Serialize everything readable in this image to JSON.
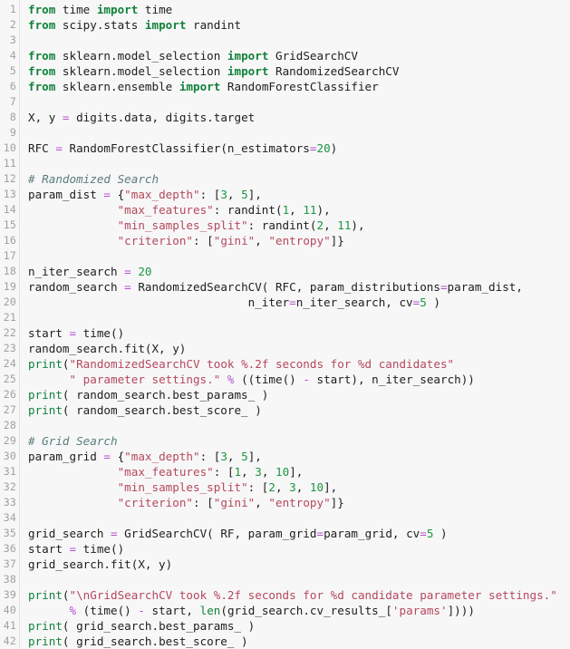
{
  "editor": {
    "name": "python-code-editor",
    "background_color": "#f7f7f7",
    "gutter_color": "#a0a0a0",
    "line_count": 42,
    "colors": {
      "keyword": "#11823b",
      "builtin": "#11823b",
      "string": "#b5485d",
      "number": "#1a9641",
      "operator": "#b452cd",
      "comment": "#5a7d7d",
      "plain": "#202020"
    },
    "line_numbers": [
      1,
      2,
      3,
      4,
      5,
      6,
      7,
      8,
      9,
      10,
      11,
      12,
      13,
      14,
      15,
      16,
      17,
      18,
      19,
      20,
      21,
      22,
      23,
      24,
      25,
      26,
      27,
      28,
      29,
      30,
      31,
      32,
      33,
      34,
      35,
      36,
      37,
      38,
      39,
      40,
      41,
      42
    ],
    "lines": [
      [
        {
          "t": "from ",
          "c": "kw"
        },
        {
          "t": "time ",
          "c": "pl"
        },
        {
          "t": "import",
          "c": "kw"
        },
        {
          "t": " time",
          "c": "pl"
        }
      ],
      [
        {
          "t": "from ",
          "c": "kw"
        },
        {
          "t": "scipy.stats ",
          "c": "pl"
        },
        {
          "t": "import",
          "c": "kw"
        },
        {
          "t": " randint",
          "c": "pl"
        }
      ],
      [],
      [
        {
          "t": "from ",
          "c": "kw"
        },
        {
          "t": "sklearn.model_selection ",
          "c": "pl"
        },
        {
          "t": "import",
          "c": "kw"
        },
        {
          "t": " GridSearchCV",
          "c": "pl"
        }
      ],
      [
        {
          "t": "from ",
          "c": "kw"
        },
        {
          "t": "sklearn.model_selection ",
          "c": "pl"
        },
        {
          "t": "import",
          "c": "kw"
        },
        {
          "t": " RandomizedSearchCV",
          "c": "pl"
        }
      ],
      [
        {
          "t": "from ",
          "c": "kw"
        },
        {
          "t": "sklearn.ensemble ",
          "c": "pl"
        },
        {
          "t": "import",
          "c": "kw"
        },
        {
          "t": " RandomForestClassifier",
          "c": "pl"
        }
      ],
      [],
      [
        {
          "t": "X, y ",
          "c": "pl"
        },
        {
          "t": "=",
          "c": "op"
        },
        {
          "t": " digits.data, digits.target",
          "c": "pl"
        }
      ],
      [],
      [
        {
          "t": "RFC ",
          "c": "pl"
        },
        {
          "t": "=",
          "c": "op"
        },
        {
          "t": " RandomForestClassifier(n_estimators",
          "c": "pl"
        },
        {
          "t": "=",
          "c": "op"
        },
        {
          "t": "20",
          "c": "num"
        },
        {
          "t": ")",
          "c": "pl"
        }
      ],
      [],
      [
        {
          "t": "# Randomized Search",
          "c": "cm"
        }
      ],
      [
        {
          "t": "param_dist ",
          "c": "pl"
        },
        {
          "t": "=",
          "c": "op"
        },
        {
          "t": " {",
          "c": "pl"
        },
        {
          "t": "\"max_depth\"",
          "c": "str"
        },
        {
          "t": ": [",
          "c": "pl"
        },
        {
          "t": "3",
          "c": "num"
        },
        {
          "t": ", ",
          "c": "pl"
        },
        {
          "t": "5",
          "c": "num"
        },
        {
          "t": "],",
          "c": "pl"
        }
      ],
      [
        {
          "t": "             ",
          "c": "pl"
        },
        {
          "t": "\"max_features\"",
          "c": "str"
        },
        {
          "t": ": randint(",
          "c": "pl"
        },
        {
          "t": "1",
          "c": "num"
        },
        {
          "t": ", ",
          "c": "pl"
        },
        {
          "t": "11",
          "c": "num"
        },
        {
          "t": "),",
          "c": "pl"
        }
      ],
      [
        {
          "t": "             ",
          "c": "pl"
        },
        {
          "t": "\"min_samples_split\"",
          "c": "str"
        },
        {
          "t": ": randint(",
          "c": "pl"
        },
        {
          "t": "2",
          "c": "num"
        },
        {
          "t": ", ",
          "c": "pl"
        },
        {
          "t": "11",
          "c": "num"
        },
        {
          "t": "),",
          "c": "pl"
        }
      ],
      [
        {
          "t": "             ",
          "c": "pl"
        },
        {
          "t": "\"criterion\"",
          "c": "str"
        },
        {
          "t": ": [",
          "c": "pl"
        },
        {
          "t": "\"gini\"",
          "c": "str"
        },
        {
          "t": ", ",
          "c": "pl"
        },
        {
          "t": "\"entropy\"",
          "c": "str"
        },
        {
          "t": "]}",
          "c": "pl"
        }
      ],
      [],
      [
        {
          "t": "n_iter_search ",
          "c": "pl"
        },
        {
          "t": "=",
          "c": "op"
        },
        {
          "t": " ",
          "c": "pl"
        },
        {
          "t": "20",
          "c": "num"
        }
      ],
      [
        {
          "t": "random_search ",
          "c": "pl"
        },
        {
          "t": "=",
          "c": "op"
        },
        {
          "t": " RandomizedSearchCV( RFC, param_distributions",
          "c": "pl"
        },
        {
          "t": "=",
          "c": "op"
        },
        {
          "t": "param_dist,",
          "c": "pl"
        }
      ],
      [
        {
          "t": "                                n_iter",
          "c": "pl"
        },
        {
          "t": "=",
          "c": "op"
        },
        {
          "t": "n_iter_search, cv",
          "c": "pl"
        },
        {
          "t": "=",
          "c": "op"
        },
        {
          "t": "5",
          "c": "num"
        },
        {
          "t": " )",
          "c": "pl"
        }
      ],
      [],
      [
        {
          "t": "start ",
          "c": "pl"
        },
        {
          "t": "=",
          "c": "op"
        },
        {
          "t": " time()",
          "c": "pl"
        }
      ],
      [
        {
          "t": "random_search.fit(X, y)",
          "c": "pl"
        }
      ],
      [
        {
          "t": "print",
          "c": "bi"
        },
        {
          "t": "(",
          "c": "pl"
        },
        {
          "t": "\"RandomizedSearchCV took %.2f seconds for %d candidates\"",
          "c": "str"
        }
      ],
      [
        {
          "t": "      ",
          "c": "pl"
        },
        {
          "t": "\" parameter settings.\"",
          "c": "str"
        },
        {
          "t": " ",
          "c": "pl"
        },
        {
          "t": "%",
          "c": "op"
        },
        {
          "t": " ((time() ",
          "c": "pl"
        },
        {
          "t": "-",
          "c": "op"
        },
        {
          "t": " start), n_iter_search))",
          "c": "pl"
        }
      ],
      [
        {
          "t": "print",
          "c": "bi"
        },
        {
          "t": "( random_search.best_params_ )",
          "c": "pl"
        }
      ],
      [
        {
          "t": "print",
          "c": "bi"
        },
        {
          "t": "( random_search.best_score_ )",
          "c": "pl"
        }
      ],
      [],
      [
        {
          "t": "# Grid Search",
          "c": "cm"
        }
      ],
      [
        {
          "t": "param_grid ",
          "c": "pl"
        },
        {
          "t": "=",
          "c": "op"
        },
        {
          "t": " {",
          "c": "pl"
        },
        {
          "t": "\"max_depth\"",
          "c": "str"
        },
        {
          "t": ": [",
          "c": "pl"
        },
        {
          "t": "3",
          "c": "num"
        },
        {
          "t": ", ",
          "c": "pl"
        },
        {
          "t": "5",
          "c": "num"
        },
        {
          "t": "],",
          "c": "pl"
        }
      ],
      [
        {
          "t": "             ",
          "c": "pl"
        },
        {
          "t": "\"max_features\"",
          "c": "str"
        },
        {
          "t": ": [",
          "c": "pl"
        },
        {
          "t": "1",
          "c": "num"
        },
        {
          "t": ", ",
          "c": "pl"
        },
        {
          "t": "3",
          "c": "num"
        },
        {
          "t": ", ",
          "c": "pl"
        },
        {
          "t": "10",
          "c": "num"
        },
        {
          "t": "],",
          "c": "pl"
        }
      ],
      [
        {
          "t": "             ",
          "c": "pl"
        },
        {
          "t": "\"min_samples_split\"",
          "c": "str"
        },
        {
          "t": ": [",
          "c": "pl"
        },
        {
          "t": "2",
          "c": "num"
        },
        {
          "t": ", ",
          "c": "pl"
        },
        {
          "t": "3",
          "c": "num"
        },
        {
          "t": ", ",
          "c": "pl"
        },
        {
          "t": "10",
          "c": "num"
        },
        {
          "t": "],",
          "c": "pl"
        }
      ],
      [
        {
          "t": "             ",
          "c": "pl"
        },
        {
          "t": "\"criterion\"",
          "c": "str"
        },
        {
          "t": ": [",
          "c": "pl"
        },
        {
          "t": "\"gini\"",
          "c": "str"
        },
        {
          "t": ", ",
          "c": "pl"
        },
        {
          "t": "\"entropy\"",
          "c": "str"
        },
        {
          "t": "]}",
          "c": "pl"
        }
      ],
      [],
      [
        {
          "t": "grid_search ",
          "c": "pl"
        },
        {
          "t": "=",
          "c": "op"
        },
        {
          "t": " GridSearchCV( RF, param_grid",
          "c": "pl"
        },
        {
          "t": "=",
          "c": "op"
        },
        {
          "t": "param_grid, cv",
          "c": "pl"
        },
        {
          "t": "=",
          "c": "op"
        },
        {
          "t": "5",
          "c": "num"
        },
        {
          "t": " )",
          "c": "pl"
        }
      ],
      [
        {
          "t": "start ",
          "c": "pl"
        },
        {
          "t": "=",
          "c": "op"
        },
        {
          "t": " time()",
          "c": "pl"
        }
      ],
      [
        {
          "t": "grid_search.fit(X, y)",
          "c": "pl"
        }
      ],
      [],
      [
        {
          "t": "print",
          "c": "bi"
        },
        {
          "t": "(",
          "c": "pl"
        },
        {
          "t": "\"\\nGridSearchCV took %.2f seconds for %d candidate parameter settings.\"",
          "c": "str"
        }
      ],
      [
        {
          "t": "      ",
          "c": "pl"
        },
        {
          "t": "%",
          "c": "op"
        },
        {
          "t": " (time() ",
          "c": "pl"
        },
        {
          "t": "-",
          "c": "op"
        },
        {
          "t": " start, ",
          "c": "pl"
        },
        {
          "t": "len",
          "c": "bi"
        },
        {
          "t": "(grid_search.cv_results_[",
          "c": "pl"
        },
        {
          "t": "'params'",
          "c": "str"
        },
        {
          "t": "])))",
          "c": "pl"
        }
      ],
      [
        {
          "t": "print",
          "c": "bi"
        },
        {
          "t": "( grid_search.best_params_ )",
          "c": "pl"
        }
      ],
      [
        {
          "t": "print",
          "c": "bi"
        },
        {
          "t": "( grid_search.best_score_ )",
          "c": "pl"
        }
      ]
    ],
    "plain_text_lines": [
      "from time import time",
      "from scipy.stats import randint",
      "",
      "from sklearn.model_selection import GridSearchCV",
      "from sklearn.model_selection import RandomizedSearchCV",
      "from sklearn.ensemble import RandomForestClassifier",
      "",
      "X, y = digits.data, digits.target",
      "",
      "RFC = RandomForestClassifier(n_estimators=20)",
      "",
      "# Randomized Search",
      "param_dist = {\"max_depth\": [3, 5],",
      "             \"max_features\": randint(1, 11),",
      "             \"min_samples_split\": randint(2, 11),",
      "             \"criterion\": [\"gini\", \"entropy\"]}",
      "",
      "n_iter_search = 20",
      "random_search = RandomizedSearchCV( RFC, param_distributions=param_dist,",
      "                                n_iter=n_iter_search, cv=5 )",
      "",
      "start = time()",
      "random_search.fit(X, y)",
      "print(\"RandomizedSearchCV took %.2f seconds for %d candidates\"",
      "      \" parameter settings.\" % ((time() - start), n_iter_search))",
      "print( random_search.best_params_ )",
      "print( random_search.best_score_ )",
      "",
      "# Grid Search",
      "param_grid = {\"max_depth\": [3, 5],",
      "             \"max_features\": [1, 3, 10],",
      "             \"min_samples_split\": [2, 3, 10],",
      "             \"criterion\": [\"gini\", \"entropy\"]}",
      "",
      "grid_search = GridSearchCV( RF, param_grid=param_grid, cv=5 )",
      "start = time()",
      "grid_search.fit(X, y)",
      "",
      "print(\"\\nGridSearchCV took %.2f seconds for %d candidate parameter settings.\"",
      "      % (time() - start, len(grid_search.cv_results_['params'])))",
      "print( grid_search.best_params_ )",
      "print( grid_search.best_score_ )"
    ]
  }
}
